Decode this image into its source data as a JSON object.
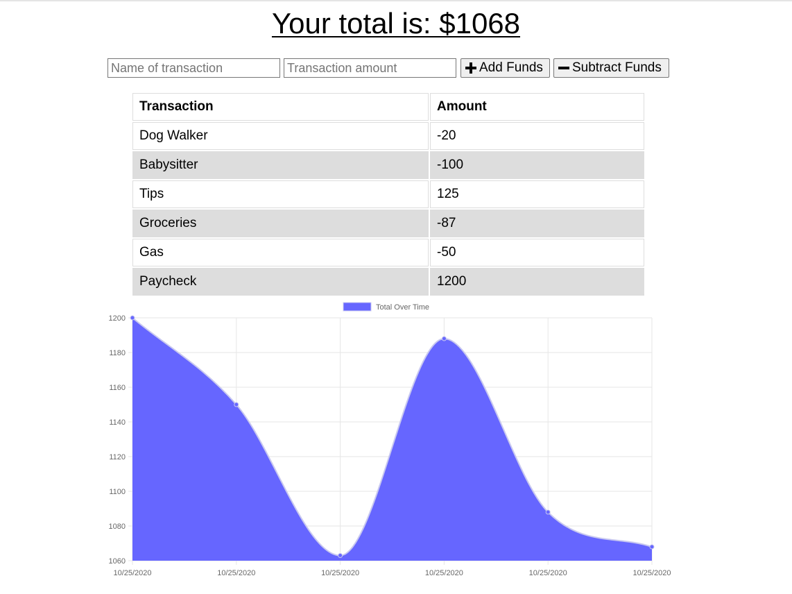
{
  "header": {
    "title": "Your total is: $1068"
  },
  "form": {
    "name_placeholder": "Name of transaction",
    "amount_placeholder": "Transaction amount",
    "add_label": "Add Funds",
    "subtract_label": "Subtract Funds",
    "add_icon": "plus-icon",
    "subtract_icon": "minus-icon"
  },
  "table": {
    "headers": [
      "Transaction",
      "Amount"
    ],
    "rows": [
      {
        "name": "Dog Walker",
        "amount": "-20"
      },
      {
        "name": "Babysitter",
        "amount": "-100"
      },
      {
        "name": "Tips",
        "amount": "125"
      },
      {
        "name": "Groceries",
        "amount": "-87"
      },
      {
        "name": "Gas",
        "amount": "-50"
      },
      {
        "name": "Paycheck",
        "amount": "1200"
      }
    ]
  },
  "colors": {
    "fill": "#6666ff",
    "line": "#c8c8f0",
    "row_alt": "#dddddd",
    "grid": "#e6e6e6"
  },
  "chart_data": {
    "type": "area",
    "title": "",
    "legend": "top",
    "categories": [
      "10/25/2020",
      "10/25/2020",
      "10/25/2020",
      "10/25/2020",
      "10/25/2020",
      "10/25/2020"
    ],
    "series": [
      {
        "name": "Total Over Time",
        "values": [
          1200,
          1150,
          1063,
          1188,
          1088,
          1068
        ]
      }
    ],
    "ylim": [
      1060,
      1200
    ],
    "yticks": [
      1060,
      1080,
      1100,
      1120,
      1140,
      1160,
      1180,
      1200
    ],
    "grid": true
  }
}
